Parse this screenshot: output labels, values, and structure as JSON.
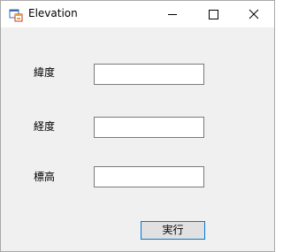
{
  "window": {
    "title": "Elevation"
  },
  "titlebar_controls": {
    "minimize_icon": "minimize-icon",
    "maximize_icon": "maximize-icon",
    "close_icon": "close-icon"
  },
  "form": {
    "fields": [
      {
        "label": "緯度",
        "value": ""
      },
      {
        "label": "経度",
        "value": ""
      },
      {
        "label": "標高",
        "value": ""
      }
    ],
    "run_label": "実行"
  }
}
